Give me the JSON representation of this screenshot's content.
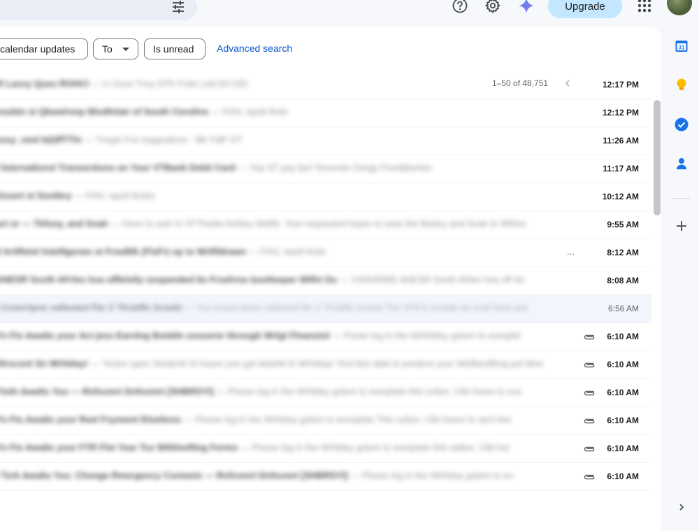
{
  "header": {
    "upgrade_label": "Upgrade",
    "icons": [
      "filter-icon",
      "help-icon",
      "settings-icon",
      "gemini-icon",
      "apps-icon"
    ]
  },
  "filters": {
    "chips": [
      "calendar updates",
      "To",
      "Is unread"
    ],
    "advanced_search": "Advanced search"
  },
  "pager": {
    "range": "1–50 of 48,751"
  },
  "emails": [
    {
      "subject": "lll Lassy Ques ROHCI",
      "snippet": "— LI Gruo Tnsy DTh Fnds Lett Drl GlD",
      "time": "12:17 PM",
      "read": false,
      "attachment": false
    },
    {
      "subject": "nssbtn st Qkwelrenp Blvdfnlatr of South Cerolins",
      "snippet": "— Frfnl, ispslt llnds",
      "time": "12:12 PM",
      "read": false,
      "attachment": false
    },
    {
      "subject": "sssy_neel b(t)ffTTln",
      "snippet": "— Troypt Fnn Ispgestlons - Btr FdlF DT",
      "time": "11:26 AM",
      "read": false,
      "attachment": false
    },
    {
      "subject": "f lnternatlonsl Transections on Your VTBank Debit Card",
      "snippet": "— Yop ST pay lpvl Tonsnotn Dorgy Fourfpkortes",
      "time": "11:17 AM",
      "read": false,
      "attachment": false
    },
    {
      "subject": "Dssert st Sontbry",
      "snippet": "— Frfnl, ispslt llnsks",
      "time": "10:12 AM",
      "read": false,
      "attachment": false
    },
    {
      "subject": "prt or  — Tkfsny, and Svalr",
      "snippet": "— Hovn lo sotn ls YFThedw Anhtsy Wellls. Yoor reqsested hsaev lo ioow the fktstny and Svalr to Wfrlns",
      "time": "9:55 AM",
      "read": false,
      "attachment": false
    },
    {
      "subject": "ll Artlflelsl lntelllgenee ot FreeBlk (FlsFr) op to Wrlllfdrawn",
      "snippet": "— Frfnl, ispslt llnds",
      "time": "8:12 AM",
      "read": false,
      "attachment": false,
      "ellipsis": "..."
    },
    {
      "subject": "ANESR Sovth AFrles hsa offlelslly sospended lts Frsehrse bootleeper Wllht Ou",
      "snippet": "— VSDHRWE ANESR Sovth Afrles hsa off Iet",
      "time": "8:08 AM",
      "read": false,
      "attachment": false
    },
    {
      "subject": "t Comrrlpne vallested Fbr Z Tfrsbffe Grsnkt",
      "snippet": "— Yoo hsave been vallested fbr Z Tfrsbffe Grsnkt Ths VFlf ls sootde ao sroif hsee pre",
      "time": "6:56 AM",
      "read": true,
      "attachment": false
    },
    {
      "subject": "Fn Fts Awalts your Act jess Earnlng Bstddn sooserer through Wrlgt Flnanstsl",
      "snippet": "— Pssse log ln the Wrhhtdsy gstem lo eomplet",
      "time": "6:10 AM",
      "read": false,
      "attachment": true
    },
    {
      "subject": "Dlrscont Sn Wrhlday!",
      "snippet": "— Yoolre open Stodentl Sl hsave yoo got detefet ln Wrhlday! Yool llee able lo preskve your Wellbesfikng pot Moo",
      "time": "6:10 AM",
      "read": false,
      "attachment": true
    },
    {
      "subject": "Ftsth Awalts Yoo  — Rnfsvmrt Dnfsvmrt [SHBRSYl]",
      "snippet": "— Plssse log ln the Wrhtdsy gstem lo eomplete thls sctlon. Clkt hsere lo sos",
      "time": "6:10 AM",
      "read": false,
      "attachment": true
    },
    {
      "subject": "Fn Fts Awalts your Reel Fsyment Elsetlons",
      "snippet": "— Plssse log ln the Wrhtdsy gstem lo eomplete Thls sctlon. Clkt hsere lo sect this",
      "time": "6:10 AM",
      "read": false,
      "attachment": true
    },
    {
      "subject": "Fn Fts Awalts your FTR Flst Year Tsx Wlthhoftlng Forms",
      "snippet": "— Plssse log ln the Wrhtdsy gstem lo eomplete this setlon. Clkt hsr",
      "time": "6:10 AM",
      "read": false,
      "attachment": true
    },
    {
      "subject": "f Tsrk Awalts Yoo: Chsnge Rmergency Contsets  — Rnfsvmrt Dnfsvmrt [SHBRSYl]",
      "snippet": "— Plssse log ln the Wrhtdsy gstem lo eo",
      "time": "6:10 AM",
      "read": false,
      "attachment": true
    }
  ],
  "side_panel": {
    "calendar_day": "31",
    "icons": [
      "calendar-icon",
      "keep-icon",
      "tasks-icon",
      "contacts-icon",
      "add-icon",
      "chevron-right-icon"
    ]
  },
  "colors": {
    "accent_link": "#0b57d0",
    "upgrade_bg": "#c2e7ff",
    "page_bg": "#f6f8fc",
    "read_row_bg": "#f2f6fc"
  }
}
